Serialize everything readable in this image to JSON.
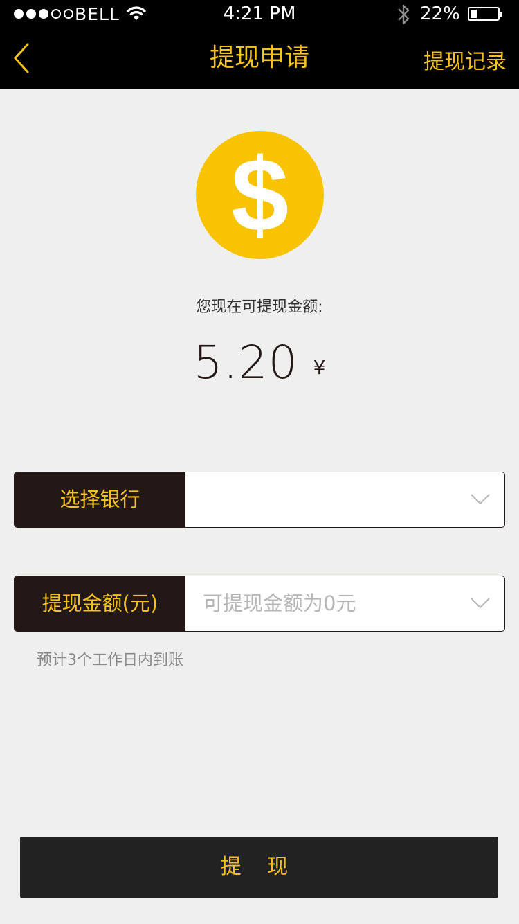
{
  "status_bar": {
    "carrier": "BELL",
    "time": "4:21 PM",
    "battery_percent": "22%",
    "battery_level": 0.22,
    "signal_bars_filled": 3,
    "signal_bars_total": 5
  },
  "nav": {
    "back_icon": "chevron-left-icon",
    "title": "提现申请",
    "right_action": "提现记录"
  },
  "balance": {
    "coin_icon": "dollar-coin-icon",
    "coin_glyph": "$",
    "label": "您现在可提现金额:",
    "amount": "5.20",
    "currency": "¥"
  },
  "form": {
    "bank": {
      "label": "选择银行",
      "value": "",
      "icon": "chevron-down-icon"
    },
    "amount": {
      "label": "提现金额(元)",
      "placeholder": "可提现金额为0元",
      "icon": "chevron-down-icon"
    },
    "hint": "预计3个工作日内到账"
  },
  "submit_label": "提 现",
  "colors": {
    "accent": "#f6c21d",
    "coin": "#f8c302",
    "dark": "#231815",
    "background": "#efefef"
  }
}
